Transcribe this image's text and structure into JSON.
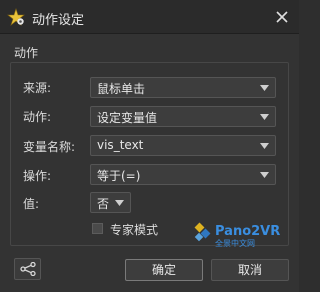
{
  "window": {
    "title": "动作设定"
  },
  "section": {
    "label": "动作"
  },
  "rows": [
    {
      "label": "来源:",
      "value": "鼠标单击"
    },
    {
      "label": "动作:",
      "value": "设定变量值"
    },
    {
      "label": "变量名称:",
      "value": "vis_text"
    },
    {
      "label": "操作:",
      "value": "等于(=)"
    },
    {
      "label": "值:",
      "value": "否"
    }
  ],
  "expert_mode": {
    "label": "专家模式",
    "checked": false
  },
  "watermark": {
    "brand": "Pano2VR",
    "sub": "全景中文网"
  },
  "buttons": {
    "ok": "确定",
    "cancel": "取消"
  },
  "colors": {
    "background": "#333333",
    "titlebar": "#2b2b2b",
    "accent_blue": "#2f7fd0",
    "accent_yellow": "#f0c020"
  }
}
